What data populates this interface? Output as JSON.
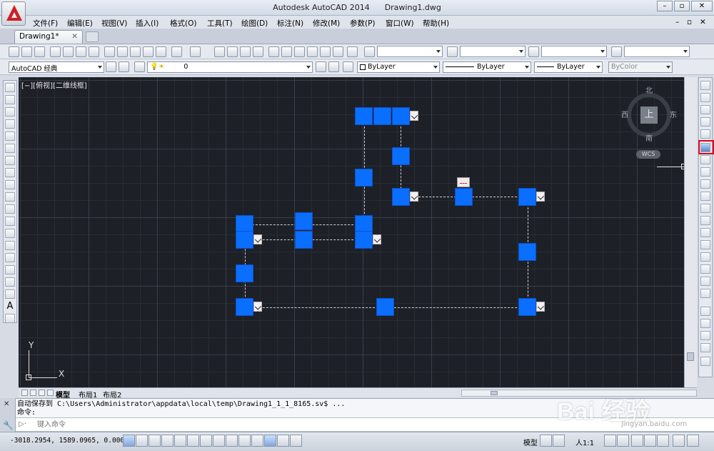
{
  "window": {
    "app_title": "Autodesk AutoCAD 2014",
    "doc_title": "Drawing1.dwg"
  },
  "menu": {
    "items": [
      "文件(F)",
      "编辑(E)",
      "视图(V)",
      "插入(I)",
      "格式(O)",
      "工具(T)",
      "绘图(D)",
      "标注(N)",
      "修改(M)",
      "参数(P)",
      "窗口(W)",
      "帮助(H)"
    ]
  },
  "tabs": {
    "active": "Drawing1*"
  },
  "toolbar": {
    "workspace": "AutoCAD 经典",
    "layer": "0",
    "color": "ByLayer",
    "linetype": "ByLayer",
    "lineweight": "ByLayer",
    "plotstyle": "ByColor"
  },
  "canvas": {
    "viewport_label": "[−][俯视][二维线框]",
    "background": "#1d2027",
    "grip_color": "#0a6fff"
  },
  "viewcube": {
    "north": "北",
    "south": "南",
    "east": "东",
    "west": "西",
    "top": "上",
    "wcs": "WCS"
  },
  "ucs": {
    "x": "X",
    "y": "Y"
  },
  "layout_tabs": {
    "model": "模型",
    "layout1": "布局1",
    "layout2": "布局2"
  },
  "command": {
    "history_line1": "自动保存到 C:\\Users\\Administrator\\appdata\\local\\temp\\Drawing1_1_1_8165.sv$ ...",
    "history_line2": "命令:",
    "placeholder": "键入命令"
  },
  "status": {
    "coords": "-3018.2954, 1589.0965, 0.0000",
    "model": "模型",
    "scale": "人1:1"
  },
  "watermark": {
    "text": "Bai 经验",
    "sub": "jingyan.baidu.com"
  }
}
